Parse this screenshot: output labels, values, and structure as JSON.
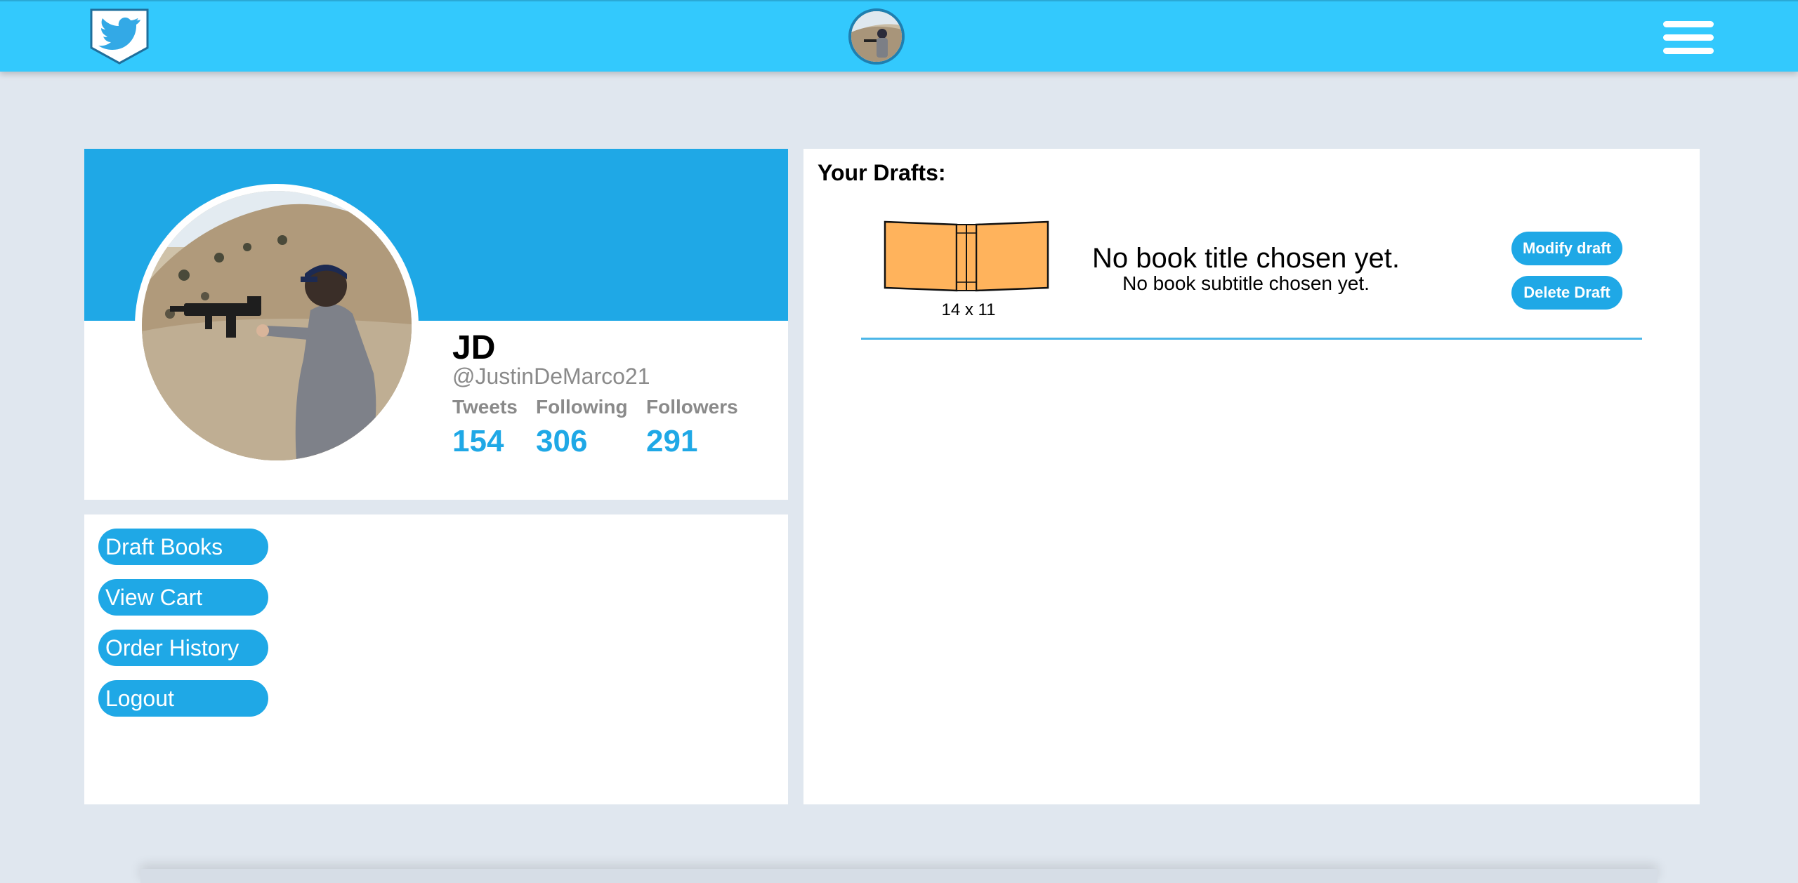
{
  "header": {
    "logo_icon": "twitter-bird-shield-icon",
    "avatar_icon": "user-avatar",
    "menu_icon": "hamburger-menu-icon"
  },
  "profile": {
    "name": "JD",
    "handle": "@JustinDeMarco21",
    "stats": [
      {
        "label": "Tweets",
        "value": "154"
      },
      {
        "label": "Following",
        "value": "306"
      },
      {
        "label": "Followers",
        "value": "291"
      }
    ]
  },
  "menu": {
    "items": [
      "Draft Books",
      "View Cart",
      "Order History",
      "Logout"
    ]
  },
  "drafts": {
    "title": "Your Drafts:",
    "items": [
      {
        "size": "14 x 11",
        "book_title": "No book title chosen yet.",
        "book_subtitle": "No book subtitle chosen yet.",
        "modify_label": "Modify draft",
        "delete_label": "Delete Draft"
      }
    ]
  },
  "colors": {
    "header": "#33c9fd",
    "accent": "#1fa8e6",
    "background": "#e0e7ef",
    "book": "#ffb35c"
  }
}
